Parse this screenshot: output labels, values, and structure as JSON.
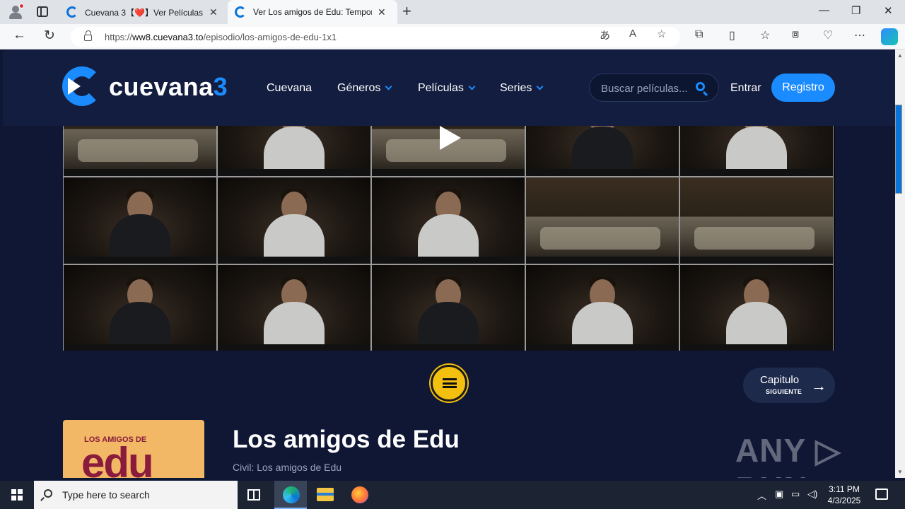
{
  "browser": {
    "tabs": [
      {
        "title": "Cuevana 3【❤️】Ver Películas, ver",
        "active": false
      },
      {
        "title": "Ver Los amigos de Edu: Tempora",
        "active": true
      }
    ],
    "url_prefix": "https://",
    "url_host": "ww8.cuevana3.to",
    "url_path": "/episodio/los-amigos-de-edu-1x1"
  },
  "site": {
    "logo_text": "cuevana",
    "logo_number": "3",
    "nav": [
      {
        "label": "Cuevana",
        "has_dropdown": false
      },
      {
        "label": "Géneros",
        "has_dropdown": true
      },
      {
        "label": "Películas",
        "has_dropdown": true
      },
      {
        "label": "Series",
        "has_dropdown": true
      }
    ],
    "search_placeholder": "Buscar películas...",
    "login_label": "Entrar",
    "register_label": "Registro",
    "accent_color": "#1a8cff"
  },
  "episode": {
    "next_label": "Capitulo",
    "next_sub": "SIGUIENTE",
    "poster_small": "LOS AMIGOS DE",
    "poster_big": "edu",
    "title": "Los amigos de Edu",
    "subtitle": "Civil: Los amigos de Edu"
  },
  "watermark": "ANY ▷ RUN",
  "taskbar": {
    "search_placeholder": "Type here to search",
    "time": "3:11 PM",
    "date": "4/3/2025"
  }
}
